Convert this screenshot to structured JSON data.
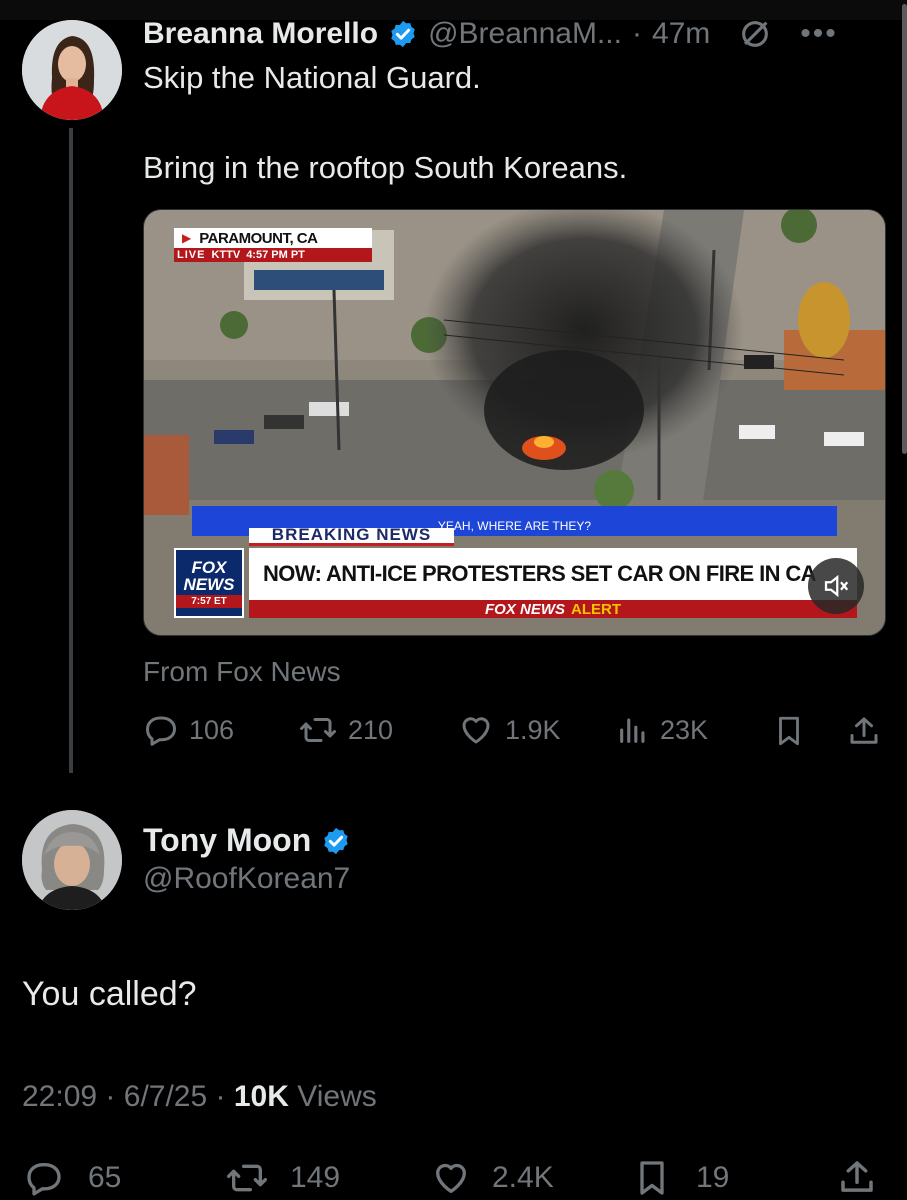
{
  "first_tweet": {
    "author_name": "Breanna Morello",
    "author_handle": "@BreannaM...",
    "separator": "·",
    "time": "47m",
    "text_line1": "Skip the National Guard.",
    "text_line2": "Bring in the rooftop South Koreans.",
    "media": {
      "location_label": "PARAMOUNT, CA",
      "live_label": "LIVE",
      "station": "KTTV",
      "local_time": "4:57 PM PT",
      "ticker_top": "YEAH, WHERE ARE THEY?",
      "breaking_label": "BREAKING NEWS",
      "headline": "NOW: ANTI-ICE PROTESTERS SET CAR ON FIRE IN CA",
      "network_line1": "FOX",
      "network_line2": "NEWS",
      "network_time": "7:57 ET",
      "alert_label_1": "FOX NEWS",
      "alert_label_2": "ALERT"
    },
    "source": "From Fox News",
    "replies": "106",
    "reposts": "210",
    "likes": "1.9K",
    "views": "23K"
  },
  "reply_tweet": {
    "author_name": "Tony Moon",
    "author_handle": "@RoofKorean7",
    "text": "You called?",
    "time": "22:09",
    "date": "6/7/25",
    "separator": "·",
    "views_count": "10K",
    "views_label": "Views",
    "replies": "65",
    "reposts": "149",
    "likes": "2.4K",
    "bookmarks": "19"
  },
  "colors": {
    "background": "#000000",
    "text": "#e7e9ea",
    "muted": "#71767b",
    "verified": "#1d9bf0"
  }
}
